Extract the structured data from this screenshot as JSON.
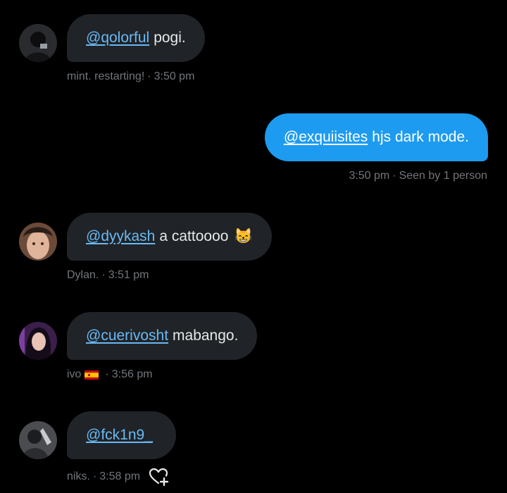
{
  "messages": [
    {
      "mention": "@qolorful",
      "text": "pogi.",
      "sender": "mint. restarting!",
      "time": "3:50 pm"
    },
    {
      "mention": "@exquiisites",
      "text": "hjs dark mode.",
      "time": "3:50 pm",
      "status": "Seen by 1 person"
    },
    {
      "mention": "@dyykash",
      "text": "a cattoooo",
      "emoji": "😸",
      "sender": "Dylan.",
      "time": "3:51 pm"
    },
    {
      "mention": "@cuerivosht",
      "text": "mabango.",
      "sender": "ivo",
      "sender_flag": "Spain",
      "time": "3:56 pm"
    },
    {
      "mention": "@fck1n9_",
      "text": "",
      "sender": "niks.",
      "time": "3:58 pm"
    }
  ],
  "separator": "·",
  "icons": {
    "react": "heart-plus-icon"
  },
  "colors": {
    "background": "#000000",
    "incoming_bubble": "#202327",
    "outgoing_bubble": "#1d9bf0",
    "mention": "#69b9f5",
    "meta_text": "#71767b"
  }
}
